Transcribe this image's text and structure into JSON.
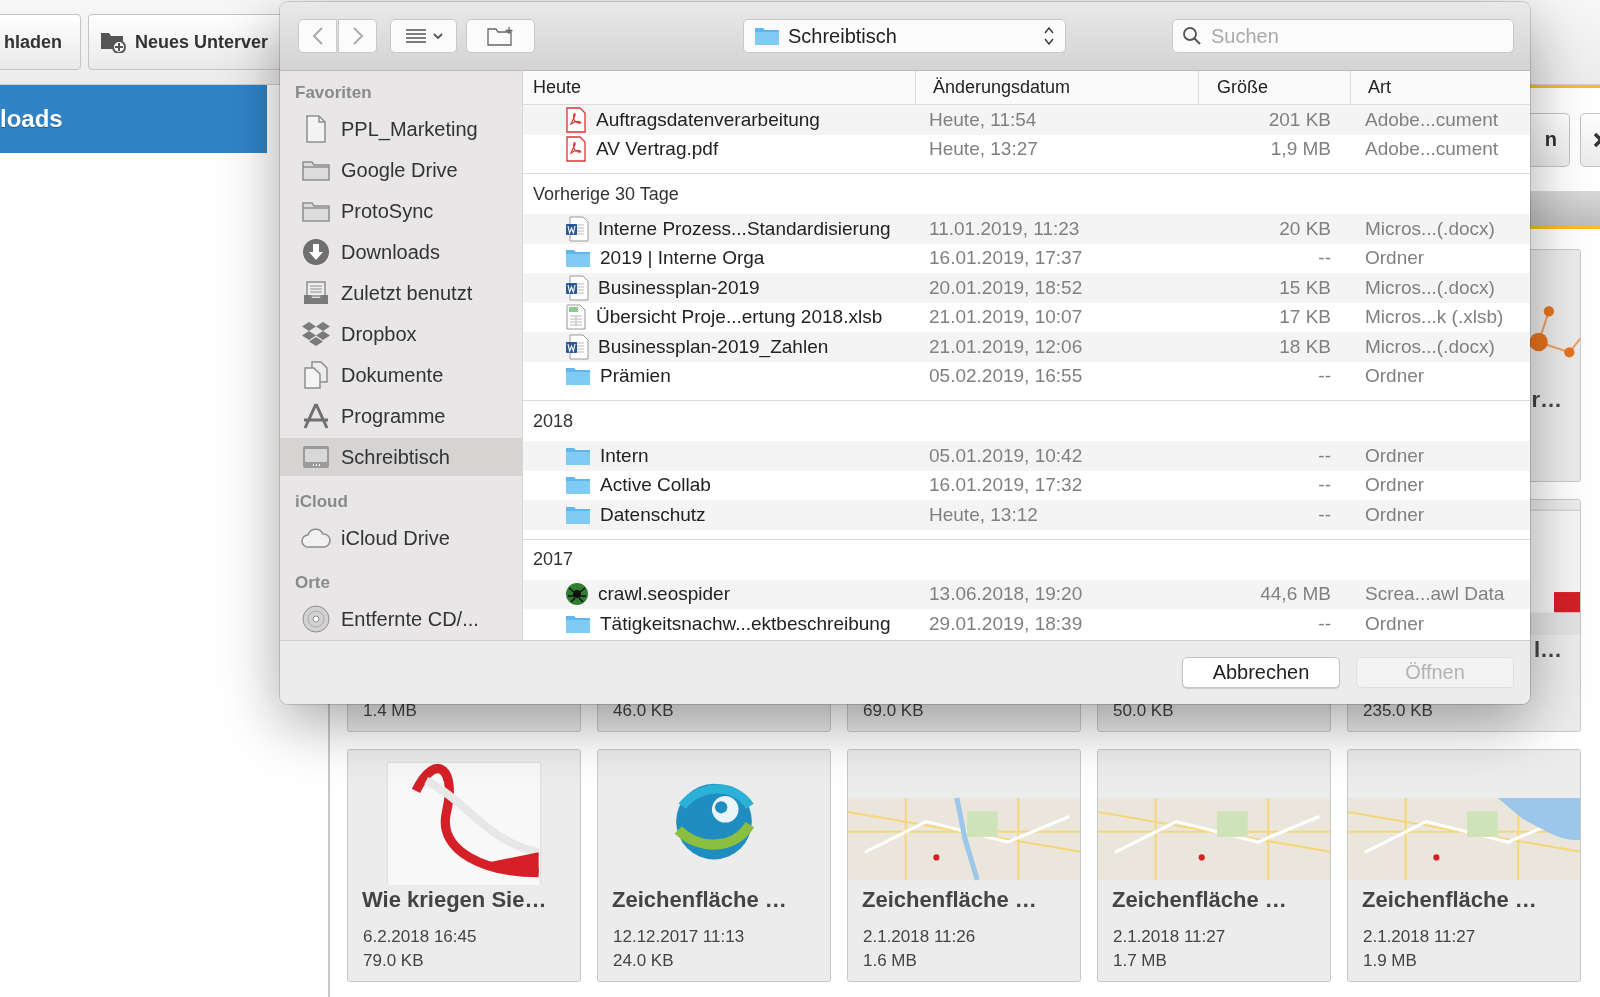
{
  "background_app": {
    "toolbar_buttons": [
      {
        "label": "hladen",
        "kind": "plain"
      },
      {
        "label": "Neues Unterver",
        "kind": "add-folder"
      }
    ],
    "sidebar_banner": "loads",
    "action_buttons": [
      {
        "label": "n",
        "kind": "text"
      },
      {
        "kind": "close"
      }
    ],
    "card_rows": [
      [
        {},
        {},
        {},
        {},
        {
          "title": "r…",
          "kind": "picture"
        }
      ],
      [
        {
          "size": "1.4 MB"
        },
        {
          "size": "46.0 KB"
        },
        {
          "size": "69.0 KB"
        },
        {
          "size": "50.0 KB"
        },
        {
          "title": "l…",
          "size": "235.0 KB",
          "kind": "picture"
        }
      ],
      [
        {
          "title": "Wie kriegen Sie…",
          "date": "6.2.2018 16:45",
          "size": "79.0 KB",
          "kind": "picture"
        },
        {
          "title": "Zeichenfläche …",
          "date": "12.12.2017 11:13",
          "size": "24.0 KB",
          "kind": "picture"
        },
        {
          "title": "Zeichenfläche …",
          "date": "2.1.2018 11:26",
          "size": "1.6 MB",
          "kind": "picture"
        },
        {
          "title": "Zeichenfläche …",
          "date": "2.1.2018 11:27",
          "size": "1.7 MB",
          "kind": "picture"
        },
        {
          "title": "Zeichenfläche …",
          "date": "2.1.2018 11:27",
          "size": "1.9 MB",
          "kind": "picture"
        }
      ]
    ]
  },
  "dialog": {
    "toolbar": {
      "back_disabled": true,
      "forward_disabled": true,
      "location": "Schreibtisch",
      "search": {
        "placeholder": "Suchen"
      }
    },
    "sidebar": [
      {
        "heading": "Favoriten",
        "items": [
          {
            "label": "PPL_Marketing",
            "kind": "file",
            "selected": false
          },
          {
            "label": "Google Drive",
            "kind": "folder",
            "selected": false
          },
          {
            "label": "ProtoSync",
            "kind": "folder",
            "selected": false
          },
          {
            "label": "Downloads",
            "kind": "downloads",
            "selected": false
          },
          {
            "label": "Zuletzt benutzt",
            "kind": "recents",
            "selected": false
          },
          {
            "label": "Dropbox",
            "kind": "dropbox",
            "selected": false
          },
          {
            "label": "Dokumente",
            "kind": "documents",
            "selected": false
          },
          {
            "label": "Programme",
            "kind": "applications",
            "selected": false
          },
          {
            "label": "Schreibtisch",
            "kind": "desktop",
            "selected": true
          }
        ]
      },
      {
        "heading": "iCloud",
        "items": [
          {
            "label": "iCloud Drive",
            "kind": "cloud",
            "selected": false
          }
        ]
      },
      {
        "heading": "Orte",
        "items": [
          {
            "label": "Entfernte CD/...",
            "kind": "disc",
            "selected": false
          }
        ]
      }
    ],
    "columns": [
      "Heute",
      "Änderungsdatum",
      "Größe",
      "Art"
    ],
    "groups": [
      {
        "rows": [
          {
            "name": "Auftragsdatenverarbeitung",
            "kind": "pdf",
            "date": "Heute, 11:54",
            "size": "201 KB",
            "type": "Adobe...cument"
          },
          {
            "name": "AV Vertrag.pdf",
            "kind": "pdf",
            "date": "Heute, 13:27",
            "size": "1,9 MB",
            "type": "Adobe...cument"
          }
        ]
      },
      {
        "heading": "Vorherige 30 Tage",
        "rows": [
          {
            "name": "Interne Prozess...Standardisierung",
            "kind": "word",
            "date": "11.01.2019, 11:23",
            "size": "20 KB",
            "type": "Micros...(.docx)"
          },
          {
            "name": "2019 | Interne Orga",
            "kind": "folder",
            "date": "16.01.2019, 17:37",
            "size": "--",
            "type": "Ordner"
          },
          {
            "name": "Businessplan-2019",
            "kind": "word",
            "date": "20.01.2019, 18:52",
            "size": "15 KB",
            "type": "Micros...(.docx)"
          },
          {
            "name": "Übersicht Proje...ertung 2018.xlsb",
            "kind": "sheet",
            "date": "21.01.2019, 10:07",
            "size": "17 KB",
            "type": "Micros...k (.xlsb)"
          },
          {
            "name": "Businessplan-2019_Zahlen",
            "kind": "word",
            "date": "21.01.2019, 12:06",
            "size": "18 KB",
            "type": "Micros...(.docx)"
          },
          {
            "name": "Prämien",
            "kind": "folder",
            "date": "05.02.2019, 16:55",
            "size": "--",
            "type": "Ordner"
          }
        ]
      },
      {
        "heading": "2018",
        "rows": [
          {
            "name": "Intern",
            "kind": "folder",
            "date": "05.01.2019, 10:42",
            "size": "--",
            "type": "Ordner"
          },
          {
            "name": "Active Collab",
            "kind": "folder",
            "date": "16.01.2019, 17:32",
            "size": "--",
            "type": "Ordner"
          },
          {
            "name": "Datenschutz",
            "kind": "folder",
            "date": "Heute, 13:12",
            "size": "--",
            "type": "Ordner"
          }
        ]
      },
      {
        "heading": "2017",
        "rows": [
          {
            "name": "crawl.seospider",
            "kind": "app",
            "date": "13.06.2018, 19:20",
            "size": "44,6 MB",
            "type": "Screa...awl Data"
          },
          {
            "name": "Tätigkeitsnachw...ektbeschreibung",
            "kind": "folder",
            "date": "29.01.2019, 18:39",
            "size": "--",
            "type": "Ordner"
          }
        ]
      }
    ],
    "buttons": [
      {
        "label": "Abbrechen",
        "disabled": false
      },
      {
        "label": "Öffnen",
        "disabled": true
      }
    ]
  }
}
